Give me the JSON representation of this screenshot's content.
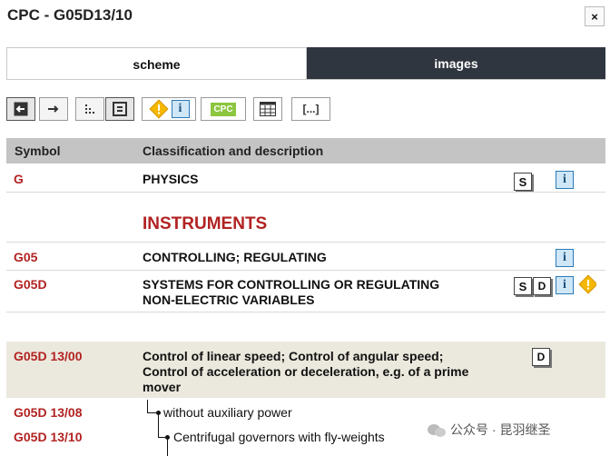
{
  "window": {
    "title": "CPC - G05D13/10",
    "close_label": "×"
  },
  "tabs": [
    {
      "label": "scheme"
    },
    {
      "label": "images"
    }
  ],
  "toolbar": {
    "cpc_badge": "CPC",
    "bracket_label": "[...]"
  },
  "table": {
    "headers": {
      "symbol": "Symbol",
      "description": "Classification and description"
    },
    "section_heading": "INSTRUMENTS",
    "rows": [
      {
        "symbol": "G",
        "line1": "PHYSICS",
        "line2": "",
        "line3": ""
      },
      {
        "symbol": "G05",
        "line1": "CONTROLLING; REGULATING",
        "line2": "",
        "line3": ""
      },
      {
        "symbol": "G05D",
        "line1": "SYSTEMS FOR CONTROLLING OR REGULATING",
        "line2": "NON-ELECTRIC VARIABLES",
        "line3": ""
      },
      {
        "symbol": "G05D 13/00",
        "line1": "Control of linear speed; Control of angular speed;",
        "line2": "Control of acceleration or deceleration, e.g. of a prime",
        "line3": "mover"
      },
      {
        "symbol": "G05D 13/08",
        "line1": "without auxiliary power",
        "line2": "",
        "line3": ""
      },
      {
        "symbol": "G05D 13/10",
        "line1": "Centrifugal governors with fly-weights",
        "line2": "",
        "line3": ""
      }
    ]
  },
  "icons": {
    "s": "S",
    "d": "D",
    "i": "i"
  },
  "watermark": "公众号 · 昆羽继圣",
  "colors": {
    "symbol": "#b22222",
    "tab_dark": "#2f3640",
    "header": "#c4c4c4",
    "highlight": "#ebe8dd",
    "cpc_green": "#8dc63f"
  }
}
